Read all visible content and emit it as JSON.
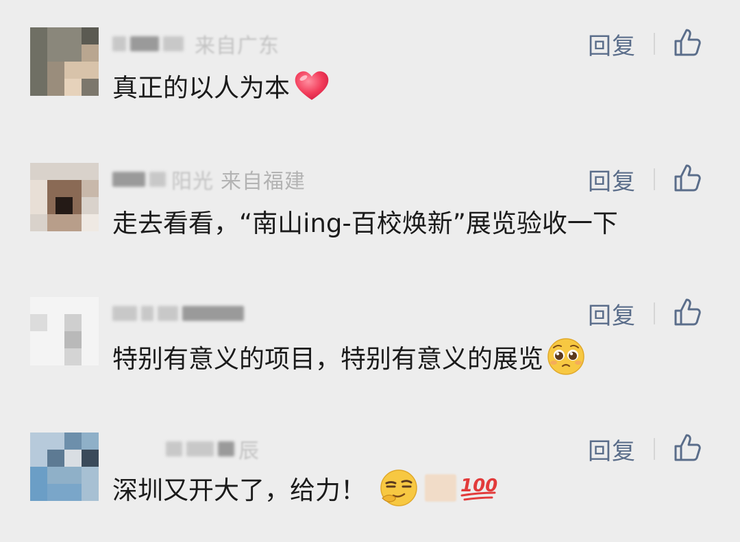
{
  "comments": [
    {
      "location": "来自广东",
      "text": "真正的以人为本",
      "reply_label": "回复",
      "emoji": "heart-emoji"
    },
    {
      "location": "来自福建",
      "name_fragment": "阳光",
      "text": "走去看看，“南山ing-百校焕新”展览验收一下",
      "reply_label": "回复"
    },
    {
      "text": "特别有意义的项目，特别有意义的展览",
      "reply_label": "回复",
      "emoji": "pleading-face-emoji"
    },
    {
      "name_fragment": "辰",
      "text": "深圳又开大了，给力！",
      "reply_label": "回复",
      "emoji": [
        "smirking-face-emoji",
        "censored-emoji",
        "hundred-points-emoji"
      ]
    }
  ],
  "colors": {
    "background": "#ededed",
    "text": "#1b1b1b",
    "link": "#5a6d8a",
    "meta": "#a8a8a8"
  }
}
